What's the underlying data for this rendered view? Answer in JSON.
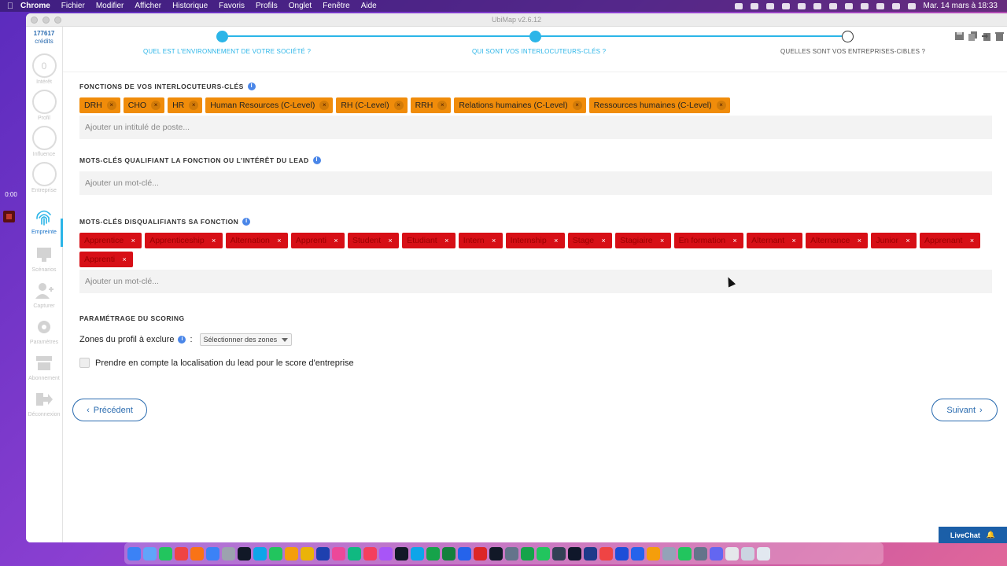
{
  "menubar": {
    "apple": "",
    "app": "Chrome",
    "items": [
      "Fichier",
      "Modifier",
      "Afficher",
      "Historique",
      "Favoris",
      "Profils",
      "Onglet",
      "Fenêtre",
      "Aide"
    ],
    "clock": "Mar. 14 mars à 18:33"
  },
  "window": {
    "title": "UbiMap v2.6.12"
  },
  "sidebar": {
    "credits_value": "177617",
    "credits_label": "crédits",
    "interet_ring": "0",
    "items": [
      {
        "label": "Intérêt"
      },
      {
        "label": "Profil"
      },
      {
        "label": "Influence"
      },
      {
        "label": "Entreprise"
      },
      {
        "label": "Empreinte"
      },
      {
        "label": "Scénarios"
      },
      {
        "label": "Capturer"
      },
      {
        "label": "Paramètres"
      },
      {
        "label": "Abonnement"
      },
      {
        "label": "Déconnexion"
      }
    ]
  },
  "stepper": {
    "steps": [
      {
        "label": "QUEL EST L'ENVIRONNEMENT DE VOTRE SOCIÉTÉ ?"
      },
      {
        "label": "QUI SONT VOS INTERLOCUTEURS-CLÉS ?"
      },
      {
        "label": "QUELLES SONT VOS ENTREPRISES-CIBLES ?"
      }
    ]
  },
  "sections": {
    "fonctions": {
      "title": "FONCTIONS DE VOS INTERLOCUTEURS-CLÉS",
      "tags": [
        "DRH",
        "CHO",
        "HR",
        "Human Resources (C-Level)",
        "RH (C-Level)",
        "RRH",
        "Relations humaines (C-Level)",
        "Ressources humaines (C-Level)"
      ],
      "placeholder": "Ajouter un intitulé de poste..."
    },
    "qualifiants": {
      "title": "MOTS-CLÉS QUALIFIANT LA FONCTION OU L'INTÉRÊT DU LEAD",
      "placeholder": "Ajouter un mot-clé..."
    },
    "disqualifiants": {
      "title": "MOTS-CLÉS DISQUALIFIANTS SA FONCTION",
      "tags": [
        "Apprentice",
        "Apprenticeship",
        "Alternation",
        "Apprenti",
        "Student",
        "Etudiant",
        "Intern",
        "Internship",
        "Stage",
        "Stagiaire",
        "En formation",
        "Alternant",
        "Alternance",
        "Junior",
        "Apprenant",
        "Apprenti"
      ],
      "placeholder": "Ajouter un mot-clé..."
    },
    "scoring": {
      "title": "PARAMÉTRAGE DU SCORING",
      "zones_label": "Zones du profil à exclure",
      "zones_colon": ":",
      "zones_select": "Sélectionner des zones",
      "localisation_label": "Prendre en compte la localisation du lead pour le score d'entreprise"
    }
  },
  "nav": {
    "prev": "Précédent",
    "next": "Suivant"
  },
  "livechat": "LiveChat",
  "recorder": {
    "time": "0:00"
  }
}
